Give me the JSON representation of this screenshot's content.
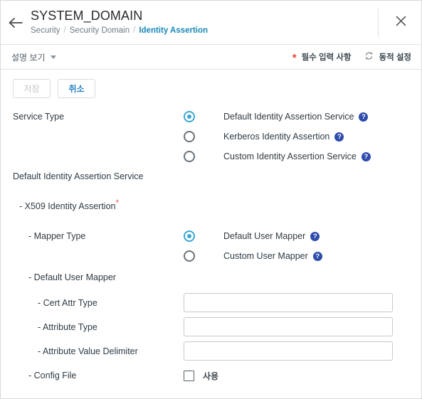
{
  "header": {
    "back_icon": "arrow-left-icon",
    "title": "SYSTEM_DOMAIN",
    "breadcrumb": [
      "Security",
      "Security Domain",
      "Identity Assertion"
    ],
    "separator": "/",
    "close_icon": "close-icon"
  },
  "toolbar": {
    "description_toggle": "설명 보기",
    "caret_icon": "chevron-down-icon",
    "required_marker": "*",
    "required_legend": "필수 입력 사항",
    "dynamic_icon": "refresh-cycle-icon",
    "dynamic_legend": "동적 설정"
  },
  "actions": {
    "save_label": "저장",
    "save_disabled": true,
    "cancel_label": "취소"
  },
  "form": {
    "service_type": {
      "label": "Service Type",
      "options": [
        {
          "label": "Default Identity Assertion Service",
          "selected": true,
          "help": "?"
        },
        {
          "label": "Kerberos Identity Assertion",
          "selected": false,
          "help": "?"
        },
        {
          "label": "Custom Identity Assertion Service",
          "selected": false,
          "help": "?"
        }
      ]
    },
    "section_heading": "Default Identity Assertion Service",
    "x509_label": "- X509 Identity Assertion",
    "x509_required": "*",
    "mapper_type": {
      "label": "- Mapper Type",
      "options": [
        {
          "label": "Default User Mapper",
          "selected": true,
          "help": "?"
        },
        {
          "label": "Custom User Mapper",
          "selected": false,
          "help": "?"
        }
      ]
    },
    "default_user_mapper_label": "- Default User Mapper",
    "fields": [
      {
        "label": "- Cert Attr Type",
        "value": "",
        "placeholder": ""
      },
      {
        "label": "- Attribute Type",
        "value": "",
        "placeholder": ""
      },
      {
        "label": "- Attribute Value Delimiter",
        "value": "",
        "placeholder": ""
      }
    ],
    "config_file": {
      "label": "- Config File",
      "checkbox_label": "사용",
      "checked": false
    }
  },
  "colors": {
    "accent_blue": "#1a88b8",
    "radio_selected": "#3aa8d4",
    "help_badge": "#2f4cad",
    "required_red": "#e8413a",
    "cancel_blue": "#2b84c6"
  }
}
